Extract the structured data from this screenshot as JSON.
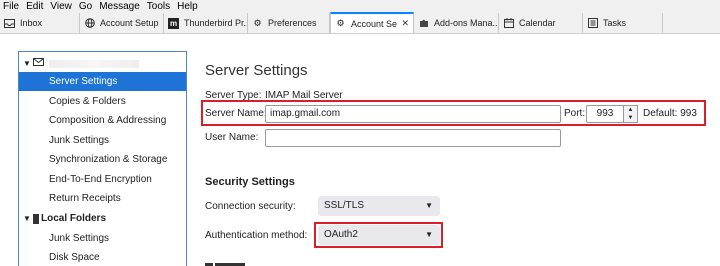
{
  "menu": [
    "File",
    "Edit",
    "View",
    "Go",
    "Message",
    "Tools",
    "Help"
  ],
  "tabs": [
    {
      "label": "Inbox",
      "icon": "inbox-icon"
    },
    {
      "label": "Account Setup",
      "icon": "globe-icon"
    },
    {
      "label": "Thunderbird Pr...",
      "icon": "m-logo-icon"
    },
    {
      "label": "Preferences",
      "icon": "gear-icon"
    },
    {
      "label": "Account Se",
      "icon": "gear-icon",
      "active": true
    },
    {
      "label": "Add-ons Mana...",
      "icon": "puzzle-icon"
    },
    {
      "label": "Calendar",
      "icon": "calendar-icon"
    },
    {
      "label": "Tasks",
      "icon": "tasks-icon"
    }
  ],
  "tree": {
    "account_items": [
      "Server Settings",
      "Copies & Folders",
      "Composition & Addressing",
      "Junk Settings",
      "Synchronization & Storage",
      "End-To-End Encryption",
      "Return Receipts"
    ],
    "local_folders_label": "Local Folders",
    "local_items": [
      "Junk Settings",
      "Disk Space"
    ]
  },
  "settings": {
    "title": "Server Settings",
    "server_type_label": "Server Type:",
    "server_type_value": "IMAP Mail Server",
    "server_name_label": "Server Name:",
    "server_name_value": "imap.gmail.com",
    "port_label": "Port:",
    "port_value": "993",
    "default_label": "Default: 993",
    "user_name_label": "User Name:",
    "user_name_value": "",
    "security_title": "Security Settings",
    "connection_security_label": "Connection security:",
    "connection_security_value": "SSL/TLS",
    "auth_method_label": "Authentication method:",
    "auth_method_value": "OAuth2"
  },
  "colors": {
    "highlight": "#d9202a",
    "selected": "#1e74d6"
  }
}
